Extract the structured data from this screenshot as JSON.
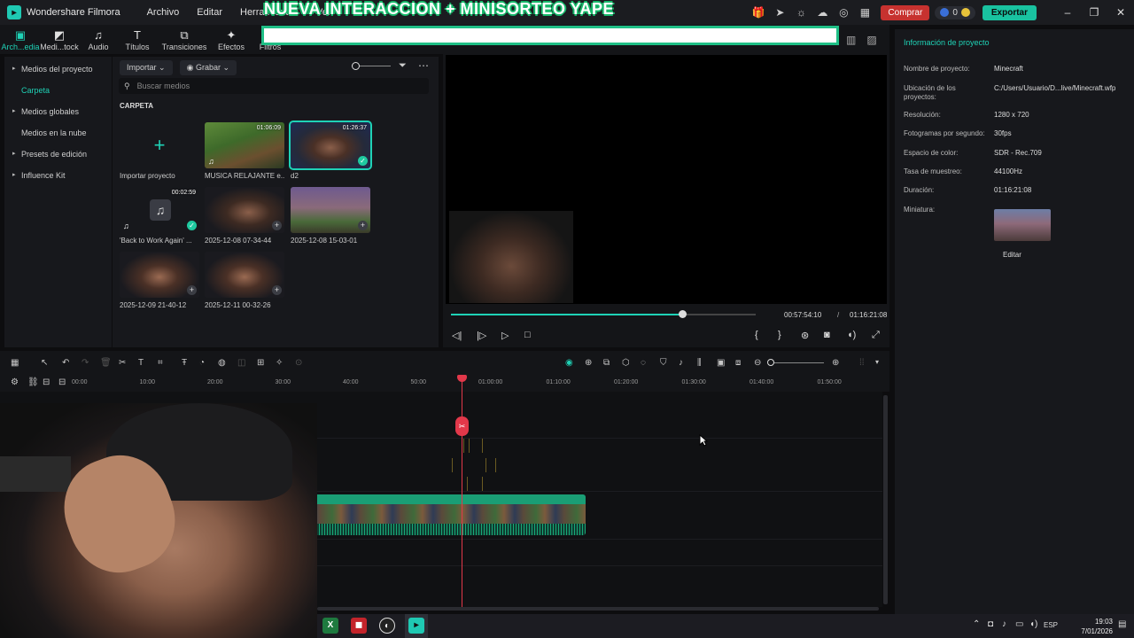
{
  "app": {
    "name": "Wondershare Filmora"
  },
  "menu": [
    "Archivo",
    "Editar",
    "Herramientas",
    "Ver"
  ],
  "overlay_title": "NUEVA INTERACCION + MINISORTEO YAPE",
  "title_bar": {
    "buy_label": "Comprar",
    "credits_count": "0",
    "export_label": "Exportar"
  },
  "toolbar": {
    "tools": [
      {
        "label": "Arch...edia",
        "icon": "folder-icon",
        "glyph": "▣"
      },
      {
        "label": "Medi...tock",
        "icon": "stock-media-icon",
        "glyph": "◩"
      },
      {
        "label": "Audio",
        "icon": "music-note-icon",
        "glyph": "♫"
      },
      {
        "label": "Títulos",
        "icon": "text-icon",
        "glyph": "T"
      },
      {
        "label": "Transiciones",
        "icon": "transition-icon",
        "glyph": "⧉"
      },
      {
        "label": "Efectos",
        "icon": "effects-icon",
        "glyph": "✦"
      },
      {
        "label": "Filtros",
        "icon": "filter-icon",
        "glyph": "◐"
      }
    ]
  },
  "sidebar": {
    "items": [
      {
        "label": "Medios del proyecto",
        "has_arrow": true
      },
      {
        "label": "Carpeta",
        "has_arrow": false,
        "active": true
      },
      {
        "label": "Medios globales",
        "has_arrow": true
      },
      {
        "label": "Medios en la nube",
        "has_arrow": false
      },
      {
        "label": "Presets de edición",
        "has_arrow": true
      },
      {
        "label": "Influence Kit",
        "has_arrow": true
      }
    ]
  },
  "media": {
    "import_label": "Importar",
    "record_label": "Grabar",
    "search_placeholder": "Buscar medios",
    "section": "CARPETA",
    "items": [
      {
        "name": "Importar proyecto",
        "duration": "",
        "kind": "import"
      },
      {
        "name": "MUSICA RELAJANTE e...",
        "duration": "01:06:09",
        "kind": "video"
      },
      {
        "name": "d2",
        "duration": "01:26:37",
        "kind": "video",
        "selected": true
      },
      {
        "name": "'Back to Work Again' ...",
        "duration": "00:02:59",
        "kind": "audio"
      },
      {
        "name": "2025-12-08 07-34-44",
        "duration": "",
        "kind": "video"
      },
      {
        "name": "2025-12-08 15-03-01",
        "duration": "",
        "kind": "video"
      },
      {
        "name": "2025-12-09 21-40-12",
        "duration": "",
        "kind": "video"
      },
      {
        "name": "2025-12-11 00-32-26",
        "duration": "",
        "kind": "video"
      }
    ]
  },
  "preview": {
    "current_time": "00:57:54:10",
    "separator": "/",
    "total_time": "01:16:21:08",
    "progress": 0.76
  },
  "project_info": {
    "title": "Información de proyecto",
    "rows": [
      {
        "key": "Nombre de proyecto:",
        "value": "Minecraft"
      },
      {
        "key": "Ubicación de los proyectos:",
        "value": "C:/Users/Usuario/D...live/Minecraft.wfp"
      },
      {
        "key": "Resolución:",
        "value": "1280 x 720"
      },
      {
        "key": "Fotogramas por segundo:",
        "value": "30fps"
      },
      {
        "key": "Espacio de color:",
        "value": "SDR - Rec.709"
      },
      {
        "key": "Tasa de muestreo:",
        "value": "44100Hz"
      },
      {
        "key": "Duración:",
        "value": "01:16:21:08"
      },
      {
        "key": "Miniatura:",
        "value": ""
      }
    ],
    "edit_label": "Editar"
  },
  "timeline": {
    "ticks": [
      "00:00",
      "10:00",
      "20:00",
      "30:00",
      "40:00",
      "50:00",
      "01:00:00",
      "01:10:00",
      "01:20:00",
      "01:30:00",
      "01:40:00",
      "01:50:00"
    ]
  },
  "taskbar": {
    "lang": "ESP",
    "time": "19:03",
    "date": "7/01/2026"
  },
  "colors": {
    "accent": "#1fd2b6",
    "playhead": "#e2384a",
    "buy": "#c7322f",
    "export": "#19c2a0"
  }
}
